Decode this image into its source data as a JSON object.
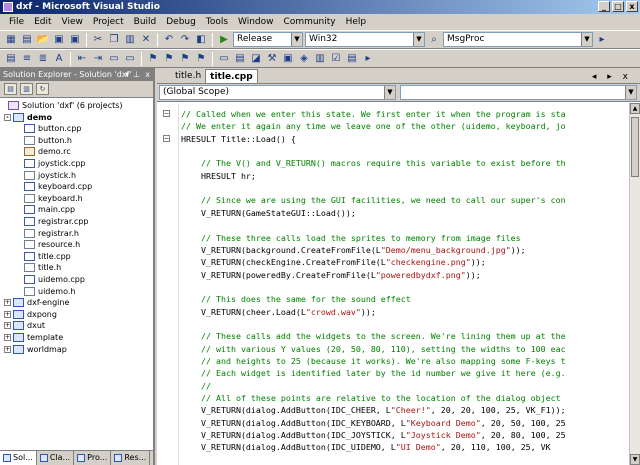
{
  "window": {
    "title": "dxf - Microsoft Visual Studio",
    "controls": [
      "_",
      "□",
      "x"
    ]
  },
  "menu": [
    "File",
    "Edit",
    "View",
    "Project",
    "Build",
    "Debug",
    "Tools",
    "Window",
    "Community",
    "Help"
  ],
  "toolbar": {
    "configuration": "Release",
    "platform": "Win32",
    "function_combo": "MsgProc"
  },
  "solution_explorer": {
    "title": "Solution Explorer - Solution 'dxf'",
    "title_controls": [
      "▾",
      "⊥",
      "x"
    ],
    "tree": [
      {
        "label": "Solution 'dxf' (6 projects)",
        "icon": "solution-icon",
        "depth": 0,
        "expander": ""
      },
      {
        "label": "demo",
        "icon": "project-icon",
        "depth": 1,
        "expander": "-",
        "bold": true
      },
      {
        "label": "button.cpp",
        "icon": "cpp-file-icon",
        "depth": 2
      },
      {
        "label": "button.h",
        "icon": "header-file-icon",
        "depth": 2
      },
      {
        "label": "demo.rc",
        "icon": "resource-file-icon",
        "depth": 2
      },
      {
        "label": "joystick.cpp",
        "icon": "cpp-file-icon",
        "depth": 2
      },
      {
        "label": "joystick.h",
        "icon": "header-file-icon",
        "depth": 2
      },
      {
        "label": "keyboard.cpp",
        "icon": "cpp-file-icon",
        "depth": 2
      },
      {
        "label": "keyboard.h",
        "icon": "header-file-icon",
        "depth": 2
      },
      {
        "label": "main.cpp",
        "icon": "cpp-file-icon",
        "depth": 2
      },
      {
        "label": "registrar.cpp",
        "icon": "cpp-file-icon",
        "depth": 2
      },
      {
        "label": "registrar.h",
        "icon": "header-file-icon",
        "depth": 2
      },
      {
        "label": "resource.h",
        "icon": "header-file-icon",
        "depth": 2
      },
      {
        "label": "title.cpp",
        "icon": "cpp-file-icon",
        "depth": 2
      },
      {
        "label": "title.h",
        "icon": "header-file-icon",
        "depth": 2
      },
      {
        "label": "uidemo.cpp",
        "icon": "cpp-file-icon",
        "depth": 2
      },
      {
        "label": "uidemo.h",
        "icon": "header-file-icon",
        "depth": 2
      },
      {
        "label": "dxf-engine",
        "icon": "project-icon",
        "depth": 1,
        "expander": "+"
      },
      {
        "label": "dxpong",
        "icon": "project-icon",
        "depth": 1,
        "expander": "+"
      },
      {
        "label": "dxut",
        "icon": "project-icon",
        "depth": 1,
        "expander": "+"
      },
      {
        "label": "template",
        "icon": "project-icon",
        "depth": 1,
        "expander": "+"
      },
      {
        "label": "worldmap",
        "icon": "project-icon",
        "depth": 1,
        "expander": "+"
      }
    ],
    "bottom_tabs": [
      "Sol...",
      "Cla...",
      "Pro...",
      "Res..."
    ]
  },
  "editor": {
    "tabs": [
      "title.h",
      "title.cpp"
    ],
    "active_tab": "title.cpp",
    "tab_controls": "◂ ▸ x",
    "scope": "(Global Scope)",
    "member": "",
    "lines": [
      {
        "kind": "com",
        "text": "// Called when we enter this state. We first enter it when the program is sta"
      },
      {
        "kind": "com",
        "text": "// We enter it again any time we leave one of the other (uidemo, keyboard, jo"
      },
      {
        "kind": "plain",
        "text": "HRESULT Title::Load() {"
      },
      {
        "kind": "plain",
        "text": ""
      },
      {
        "kind": "com",
        "text": "    // The V() and V_RETURN() macros require this variable to exist before th"
      },
      {
        "kind": "plain",
        "text": "    HRESULT hr;"
      },
      {
        "kind": "plain",
        "text": ""
      },
      {
        "kind": "com",
        "text": "    // Since we are using the GUI facilities, we need to call our super's con"
      },
      {
        "kind": "plain",
        "text": "    V_RETURN(GameStateGUI::Load());"
      },
      {
        "kind": "plain",
        "text": ""
      },
      {
        "kind": "com",
        "text": "    // These three calls load the sprites to memory from image files"
      },
      {
        "kind": "mix",
        "pre": "    V_RETURN(background.CreateFromFile(L",
        "str": "\"Demo/menu_background.jpg\"",
        "post": "));"
      },
      {
        "kind": "mix",
        "pre": "    V_RETURN(checkEngine.CreateFromFile(L",
        "str": "\"checkengine.png\"",
        "post": "));"
      },
      {
        "kind": "mix",
        "pre": "    V_RETURN(poweredBy.CreateFromFile(L",
        "str": "\"poweredbydxf.png\"",
        "post": "));"
      },
      {
        "kind": "plain",
        "text": ""
      },
      {
        "kind": "com",
        "text": "    // This does the same for the sound effect"
      },
      {
        "kind": "mix",
        "pre": "    V_RETURN(cheer.Load(L",
        "str": "\"crowd.wav\"",
        "post": "));"
      },
      {
        "kind": "plain",
        "text": ""
      },
      {
        "kind": "com",
        "text": "    // These calls add the widgets to the screen. We're lining them up at the"
      },
      {
        "kind": "com",
        "text": "    // with various Y values (20, 50, 80, 110), setting the widths to 100 eac"
      },
      {
        "kind": "com",
        "text": "    // and heights to 25 (because it works). We're also mapping some F-keys t"
      },
      {
        "kind": "com",
        "text": "    // Each widget is identified later by the id number we give it here (e.g."
      },
      {
        "kind": "com",
        "text": "    //"
      },
      {
        "kind": "com",
        "text": "    // All of these points are relative to the location of the dialog object"
      },
      {
        "kind": "mix",
        "pre": "    V_RETURN(dialog.AddButton(IDC_CHEER, L",
        "str": "\"Cheer!\"",
        "post": ", 20, 20, 100, 25, VK_F1));"
      },
      {
        "kind": "mix",
        "pre": "    V_RETURN(dialog.AddButton(IDC_KEYBOARD, L",
        "str": "\"Keyboard Demo\"",
        "post": ", 20, 50, 100, 25"
      },
      {
        "kind": "mix",
        "pre": "    V_RETURN(dialog.AddButton(IDC_JOYSTICK, L",
        "str": "\"Joystick Demo\"",
        "post": ", 20, 80, 100, 25"
      },
      {
        "kind": "mix",
        "pre": "    V_RETURN(dialog.AddButton(IDC_UIDEMO, L",
        "str": "\"UI Demo\"",
        "post": ", 20, 110, 100, 25, VK"
      }
    ]
  },
  "colors": {
    "comment": "#008000",
    "string": "#a31515",
    "titlebar": "#0a246a",
    "chrome": "#d4d0c8"
  }
}
